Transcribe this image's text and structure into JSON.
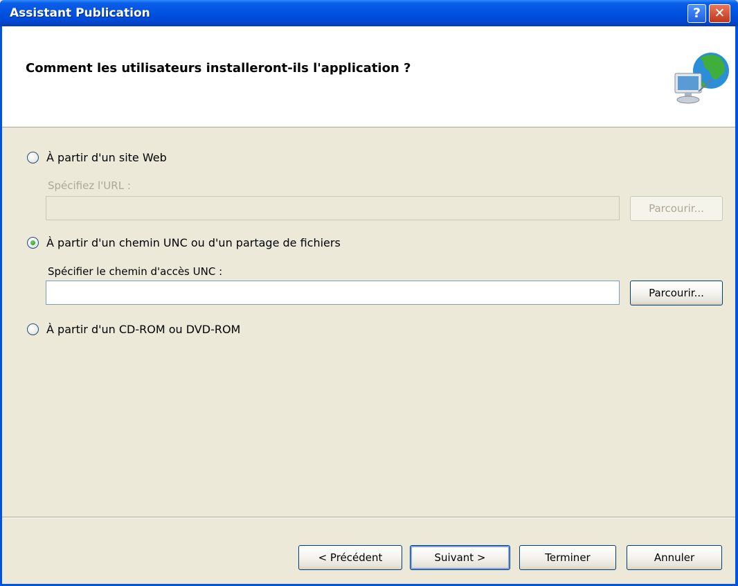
{
  "window": {
    "title": "Assistant Publication",
    "help_glyph": "?",
    "close_glyph": "✕"
  },
  "header": {
    "title": "Comment les utilisateurs installeront-ils l'application ?",
    "icon": "network-globe-icon"
  },
  "options": {
    "web": {
      "label": "À partir d'un site Web",
      "checked": false
    },
    "url_label": "Spécifiez l'URL :",
    "url_value": "",
    "url_browse": "Parcourir...",
    "unc": {
      "label": "À partir d'un chemin UNC ou d'un partage de fichiers",
      "checked": true
    },
    "unc_label": "Spécifier le chemin d'accès UNC :",
    "unc_value": "",
    "unc_browse": "Parcourir...",
    "cd": {
      "label": "À partir d'un CD-ROM ou DVD-ROM",
      "checked": false
    }
  },
  "footer": {
    "previous": "< Précédent",
    "next": "Suivant >",
    "finish": "Terminer",
    "cancel": "Annuler"
  }
}
